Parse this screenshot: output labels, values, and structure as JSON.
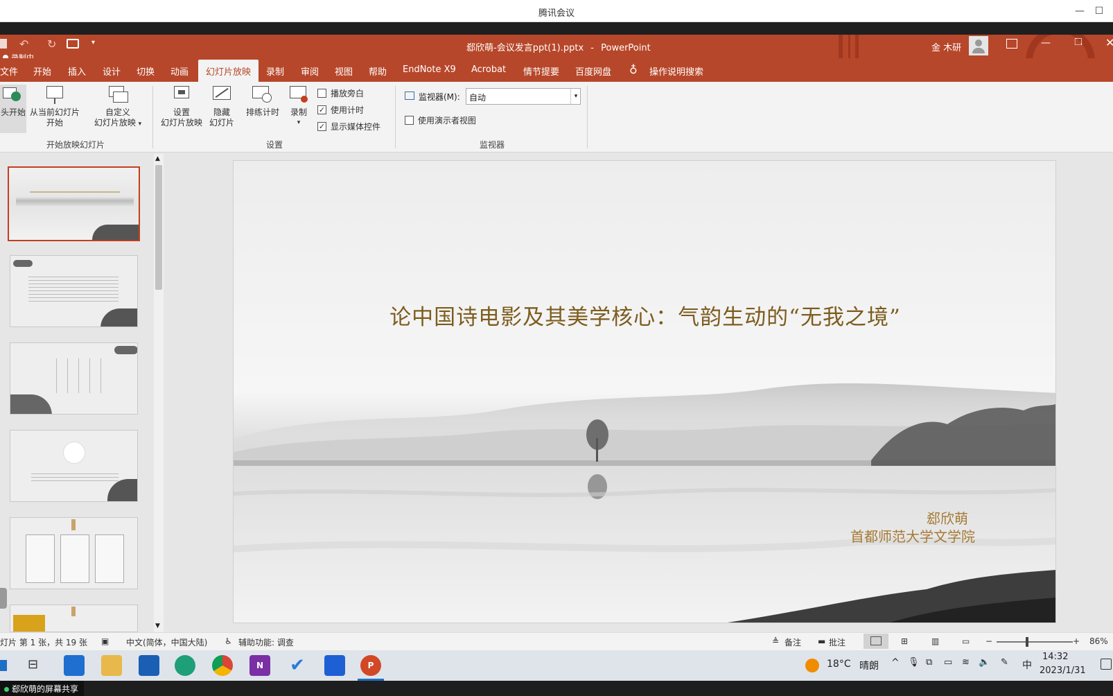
{
  "meeting": {
    "title": "腾讯会议"
  },
  "ppt": {
    "filename": "郄欣萌-会议发言ppt(1).pptx",
    "separator": "-",
    "app": "PowerPoint",
    "recording": "录制中",
    "user": "金 木研"
  },
  "tabs": [
    "文件",
    "开始",
    "插入",
    "设计",
    "切换",
    "动画",
    "幻灯片放映",
    "录制",
    "审阅",
    "视图",
    "帮助",
    "EndNote X9",
    "Acrobat",
    "情节提要",
    "百度网盘"
  ],
  "active_tab": "幻灯片放映",
  "tell_me": "操作说明搜索",
  "ribbon": {
    "start_group": {
      "from_beginning": "头开始",
      "from_current_l1": "从当前幻灯片",
      "from_current_l2": "开始",
      "custom_l1": "自定义",
      "custom_l2": "幻灯片放映",
      "label": "开始放映幻灯片"
    },
    "setup_group": {
      "setup_l1": "设置",
      "setup_l2": "幻灯片放映",
      "hide_l1": "隐藏",
      "hide_l2": "幻灯片",
      "rehearse": "排练计时",
      "record": "录制",
      "play_narration": "播放旁白",
      "use_timings": "使用计时",
      "show_media": "显示媒体控件",
      "label": "设置"
    },
    "monitor_group": {
      "monitor_label": "监视器(M):",
      "monitor_value": "自动",
      "presenter_view": "使用演示者视图",
      "label": "监视器"
    }
  },
  "checkbox_states": {
    "play_narration": false,
    "use_timings": true,
    "show_media": true,
    "presenter_view": false
  },
  "slide": {
    "title": "论中国诗电影及其美学核心：气韵生动的“无我之境”",
    "author": "郄欣萌",
    "school": "首都师范大学文学院"
  },
  "status": {
    "slide_info": "灯片 第 1 张，共 19 张",
    "language": "中文(简体，中国大陆)",
    "accessibility": "辅助功能: 调查",
    "notes": "备注",
    "comments": "批注",
    "zoom": "86%"
  },
  "taskbar": {
    "temp": "18°C",
    "weather": "晴朗",
    "ime": "中",
    "time": "14:32",
    "date": "2023/1/31"
  },
  "share": {
    "label": "郄欣萌的屏幕共享"
  },
  "colors": {
    "accent": "#b7472a",
    "slide_title": "#7d5c1e",
    "selected_thumb": "#c43e1c"
  }
}
